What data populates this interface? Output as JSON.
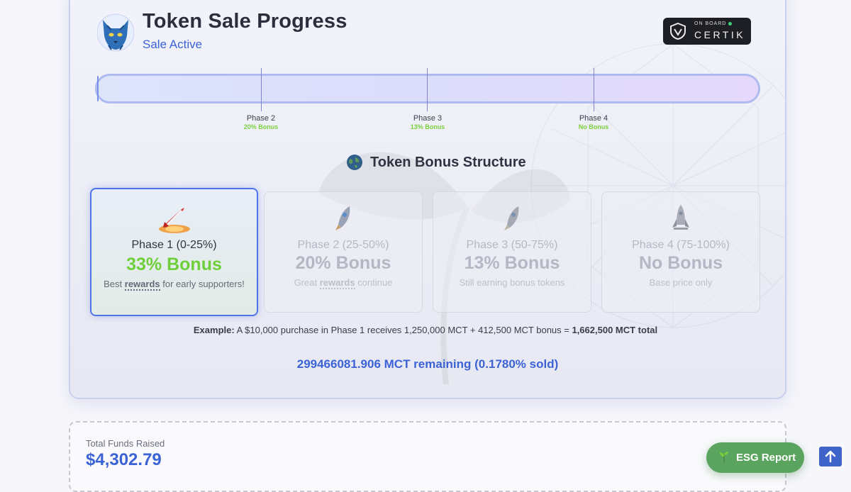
{
  "header": {
    "title": "Token Sale Progress",
    "status": "Sale Active",
    "logo_icon": "cat-logo-icon",
    "audit_badge": {
      "top_text": "ON BOARD",
      "brand": "CERTIK",
      "icon": "certik-shield-icon"
    }
  },
  "progress": {
    "percent_sold": 0.178,
    "markers": [
      {
        "label": "Phase 2",
        "bonus": "20% Bonus"
      },
      {
        "label": "Phase 3",
        "bonus": "13% Bonus"
      },
      {
        "label": "Phase 4",
        "bonus": "No Bonus"
      }
    ]
  },
  "bonus_section": {
    "heading": "Token Bonus Structure",
    "icon": "earth-icon",
    "cards": [
      {
        "phase": "Phase 1 (0-25%)",
        "bonus": "33% Bonus",
        "desc_pre": "Best ",
        "desc_em": "rewards",
        "desc_post": " for early supporters!",
        "icon": "rocket-launch-icon",
        "active": true
      },
      {
        "phase": "Phase 2 (25-50%)",
        "bonus": "20% Bonus",
        "desc_pre": "Great ",
        "desc_em": "rewards",
        "desc_post": " continue",
        "icon": "rocket-icon",
        "active": false
      },
      {
        "phase": "Phase 3 (50-75%)",
        "bonus": "13% Bonus",
        "desc_pre": "Still earning bonus tokens",
        "desc_em": "",
        "desc_post": "",
        "icon": "rocket-icon",
        "active": false
      },
      {
        "phase": "Phase 4 (75-100%)",
        "bonus": "No Bonus",
        "desc_pre": "Base price only",
        "desc_em": "",
        "desc_post": "",
        "icon": "rocket-standing-icon",
        "active": false
      }
    ]
  },
  "example": {
    "label": "Example:",
    "text": " A $10,000 purchase in Phase 1 receives 1,250,000 MCT + 412,500 MCT bonus = ",
    "total": "1,662,500 MCT total"
  },
  "remaining": "299466081.906 MCT remaining (0.1780% sold)",
  "funds": {
    "label": "Total Funds Raised",
    "value": "$4,302.79"
  },
  "buttons": {
    "esg": "ESG Report",
    "esg_icon": "leaf-icon",
    "top_icon": "arrow-up-icon"
  },
  "colors": {
    "accent": "#3b63d6",
    "bonus_green": "#6fcf3a",
    "esg_green": "#5aa45f"
  }
}
